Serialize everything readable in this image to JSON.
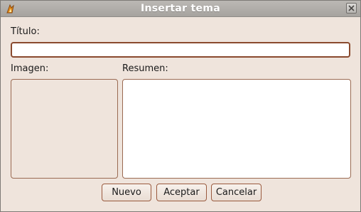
{
  "window": {
    "title": "Insertar tema",
    "close_icon": "close-icon",
    "app_icon": "app-icon"
  },
  "form": {
    "titulo_label": "Título:",
    "titulo_value": "",
    "imagen_label": "Imagen:",
    "resumen_label": "Resumen:",
    "resumen_value": ""
  },
  "buttons": {
    "nuevo": "Nuevo",
    "aceptar": "Aceptar",
    "cancelar": "Cancelar"
  },
  "colors": {
    "dialog_bg": "#efe4dc",
    "accent_border": "#9a6a52",
    "titlebar": "#a6a39f"
  }
}
